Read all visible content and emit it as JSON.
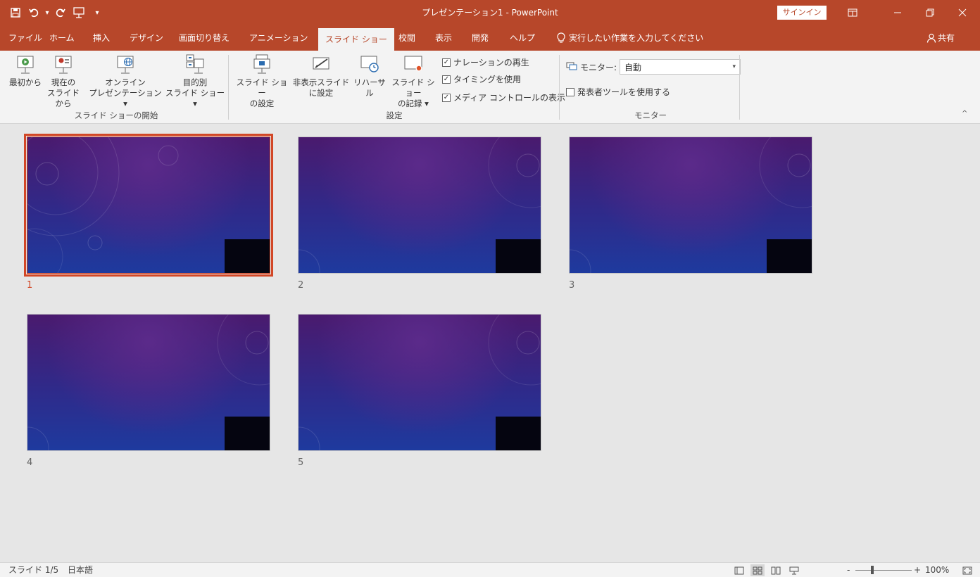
{
  "app": {
    "title": "プレゼンテーション1 - PowerPoint",
    "signin": "サインイン",
    "accent": "#b7472a"
  },
  "qat": {
    "save_icon": "save-icon",
    "undo_icon": "undo-icon",
    "redo_icon": "redo-icon",
    "start_icon": "slideshow-start-icon",
    "customize_icon": "customize-qat-icon"
  },
  "tabs": [
    {
      "label": "ファイル"
    },
    {
      "label": "ホーム"
    },
    {
      "label": "挿入"
    },
    {
      "label": "デザイン"
    },
    {
      "label": "画面切り替え"
    },
    {
      "label": "アニメーション"
    },
    {
      "label": "スライド ショー"
    },
    {
      "label": "校閲"
    },
    {
      "label": "表示"
    },
    {
      "label": "開発"
    },
    {
      "label": "ヘルプ"
    }
  ],
  "tell_me": "実行したい作業を入力してください",
  "share": "共有",
  "ribbon": {
    "start_group": {
      "label": "スライド ショーの開始",
      "from_beginning": "最初から",
      "from_current_1": "現在の",
      "from_current_2": "スライドから",
      "online_1": "オンライン",
      "online_2": "プレゼンテーション ▾",
      "custom_1": "目的別",
      "custom_2": "スライド ショー ▾"
    },
    "setup_group": {
      "label": "設定",
      "setup_1": "スライド ショー",
      "setup_2": "の設定",
      "hide_1": "非表示スライド",
      "hide_2": "に設定",
      "rehearse": "リハーサル",
      "record_1": "スライド ショー",
      "record_2": "の記録 ▾",
      "narration": "ナレーションの再生",
      "timing": "タイミングを使用",
      "media": "メディア コントロールの表示"
    },
    "monitor_group": {
      "label": "モニター",
      "monitor_label": "モニター:",
      "monitor_value": "自動",
      "presenter": "発表者ツールを使用する"
    }
  },
  "slides": [
    {
      "number": "1",
      "selected": true
    },
    {
      "number": "2",
      "selected": false
    },
    {
      "number": "3",
      "selected": false
    },
    {
      "number": "4",
      "selected": false
    },
    {
      "number": "5",
      "selected": false
    }
  ],
  "status": {
    "slide_info": "スライド 1/5",
    "language": "日本語",
    "zoom": "100%",
    "zoom_minus": "-",
    "zoom_plus": "+"
  }
}
